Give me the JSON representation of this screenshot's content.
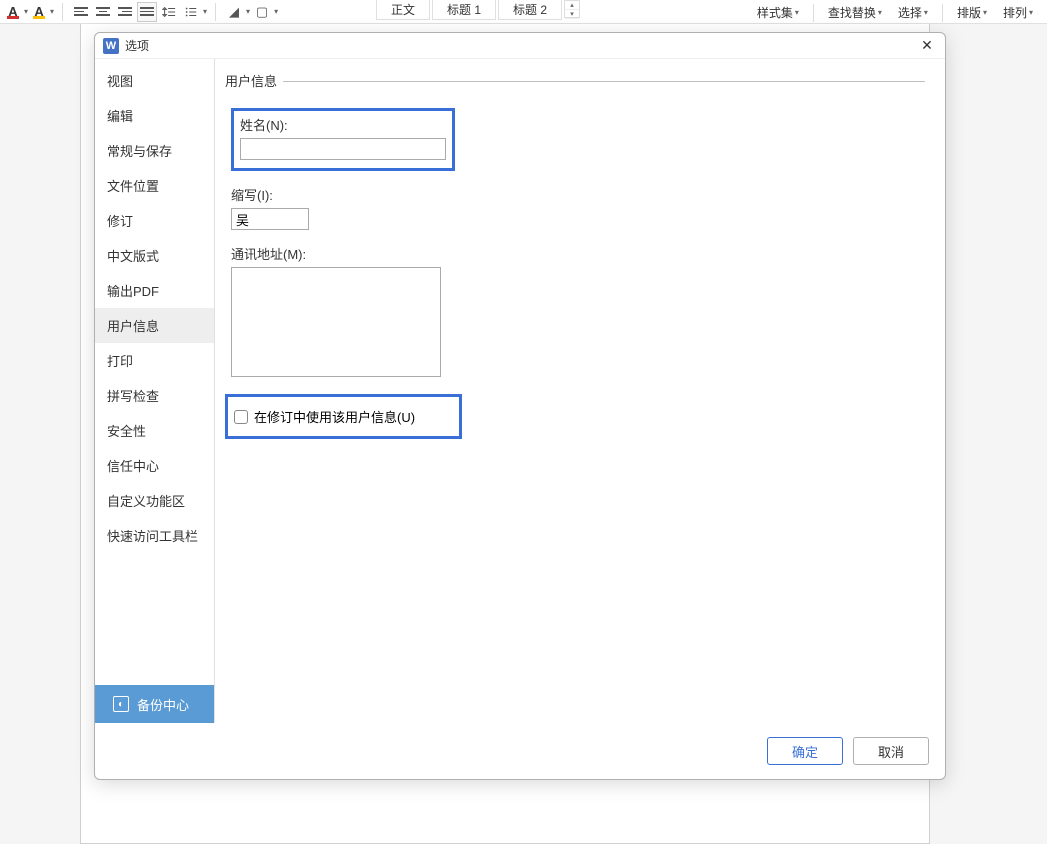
{
  "ribbon": {
    "styles": {
      "normal": "正文",
      "heading1": "标题 1",
      "heading2": "标题 2"
    },
    "right_buttons": {
      "style_set": "样式集",
      "find_replace": "查找替换",
      "select": "选择",
      "layout": "排版",
      "arrange": "排列"
    }
  },
  "dialog": {
    "title": "选项",
    "sidebar": {
      "items": [
        "视图",
        "编辑",
        "常规与保存",
        "文件位置",
        "修订",
        "中文版式",
        "输出PDF",
        "用户信息",
        "打印",
        "拼写检查",
        "安全性",
        "信任中心",
        "自定义功能区",
        "快速访问工具栏"
      ],
      "active_index": 7,
      "footer": "备份中心"
    },
    "content": {
      "section_title": "用户信息",
      "name_label": "姓名(N):",
      "name_value": "",
      "initials_label": "缩写(I):",
      "initials_value": "吴",
      "address_label": "通讯地址(M):",
      "address_value": "",
      "use_in_revision_label": "在修订中使用该用户信息(U)",
      "use_in_revision_checked": false
    },
    "buttons": {
      "ok": "确定",
      "cancel": "取消"
    }
  }
}
